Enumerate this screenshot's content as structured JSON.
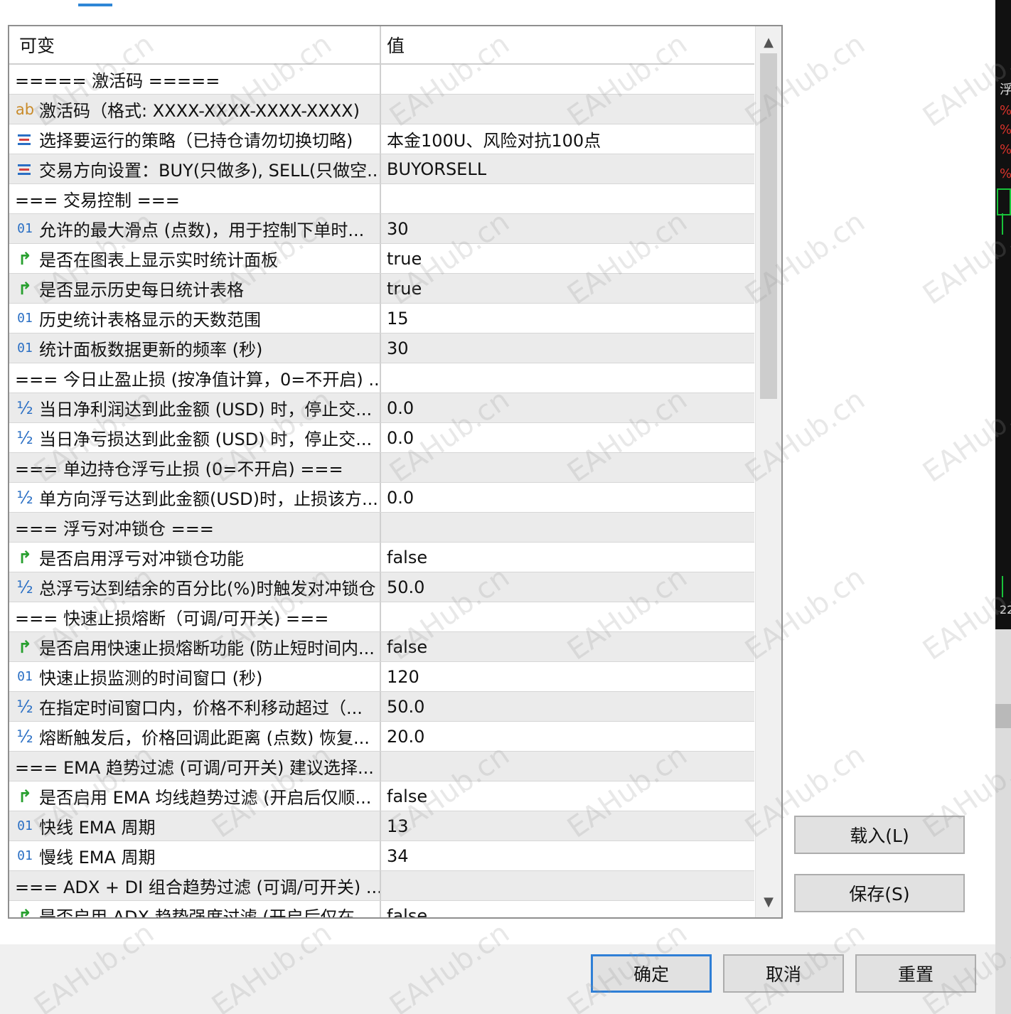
{
  "grid": {
    "headers": {
      "name": "可变",
      "value": "值"
    },
    "rows": [
      {
        "icon": "none",
        "name": "===== 激活码 =====",
        "value": ""
      },
      {
        "icon": "ab",
        "name": "激活码（格式: XXXX-XXXX-XXXX-XXXX)",
        "value": ""
      },
      {
        "icon": "enum",
        "name": "选择要运行的策略（已持仓请勿切换切略)",
        "value": "本金100U、风险对抗100点"
      },
      {
        "icon": "enum",
        "name": "交易方向设置：BUY(只做多), SELL(只做空...",
        "value": "BUYORSELL"
      },
      {
        "icon": "none",
        "name": "=== 交易控制 ===",
        "value": ""
      },
      {
        "icon": "num",
        "name": "允许的最大滑点 (点数)，用于控制下单时...",
        "value": "30"
      },
      {
        "icon": "bool",
        "name": "是否在图表上显示实时统计面板",
        "value": "true"
      },
      {
        "icon": "bool",
        "name": "是否显示历史每日统计表格",
        "value": "true"
      },
      {
        "icon": "num",
        "name": "历史统计表格显示的天数范围",
        "value": "15"
      },
      {
        "icon": "num",
        "name": "统计面板数据更新的频率 (秒)",
        "value": "30"
      },
      {
        "icon": "none",
        "name": "=== 今日止盈止损 (按净值计算，0=不开启) ...",
        "value": ""
      },
      {
        "icon": "frac",
        "name": "当日净利润达到此金额 (USD) 时，停止交...",
        "value": "0.0"
      },
      {
        "icon": "frac",
        "name": "当日净亏损达到此金额 (USD) 时，停止交...",
        "value": "0.0"
      },
      {
        "icon": "none",
        "name": "=== 单边持仓浮亏止损 (0=不开启) ===",
        "value": ""
      },
      {
        "icon": "frac",
        "name": "单方向浮亏达到此金额(USD)时，止损该方...",
        "value": "0.0"
      },
      {
        "icon": "none",
        "name": "=== 浮亏对冲锁仓 ===",
        "value": ""
      },
      {
        "icon": "bool",
        "name": "是否启用浮亏对冲锁仓功能",
        "value": "false"
      },
      {
        "icon": "frac",
        "name": "总浮亏达到结余的百分比(%)时触发对冲锁仓",
        "value": "50.0"
      },
      {
        "icon": "none",
        "name": "=== 快速止损熔断（可调/可开关) ===",
        "value": ""
      },
      {
        "icon": "bool",
        "name": "是否启用快速止损熔断功能 (防止短时间内...",
        "value": "false"
      },
      {
        "icon": "num",
        "name": "快速止损监测的时间窗口 (秒)",
        "value": "120"
      },
      {
        "icon": "frac",
        "name": "在指定时间窗口内，价格不利移动超过（...",
        "value": "50.0"
      },
      {
        "icon": "frac",
        "name": "熔断触发后，价格回调此距离 (点数) 恢复...",
        "value": "20.0"
      },
      {
        "icon": "none",
        "name": "===  EMA 趋势过滤 (可调/可开关) 建议选择...",
        "value": ""
      },
      {
        "icon": "bool",
        "name": "是否启用 EMA 均线趋势过滤 (开启后仅顺...",
        "value": "false"
      },
      {
        "icon": "num",
        "name": "快线 EMA 周期",
        "value": "13"
      },
      {
        "icon": "num",
        "name": "慢线 EMA 周期",
        "value": "34"
      },
      {
        "icon": "none",
        "name": "=== ADX + DI 组合趋势过滤 (可调/可开关) ...",
        "value": ""
      },
      {
        "icon": "bool",
        "name": "是否启用 ADX 趋势强度过滤 (开启后仅在...",
        "value": "false"
      }
    ]
  },
  "icons": {
    "ab": {
      "glyph": "ab",
      "name": "string-type-icon"
    },
    "enum": {
      "glyph": "",
      "name": "enum-type-icon"
    },
    "num": {
      "glyph": "01",
      "name": "integer-type-icon"
    },
    "frac": {
      "glyph": "½",
      "name": "double-type-icon"
    },
    "bool": {
      "glyph": "↱",
      "name": "boolean-type-icon"
    },
    "none": {
      "glyph": "",
      "name": ""
    }
  },
  "side_buttons": {
    "load": "载入(L)",
    "save": "保存(S)"
  },
  "footer": {
    "ok": "确定",
    "cancel": "取消",
    "reset": "重置"
  },
  "watermark": "EAHub.cn",
  "right_strip": {
    "labels": [
      "浮",
      "%",
      "%",
      "%",
      "%",
      "22"
    ]
  },
  "colors": {
    "accent": "#2f7fd6",
    "row_alt": "#ebebeb",
    "bool_icon": "#28a02f",
    "num_icon": "#2a6fc4",
    "string_icon": "#c98b2a"
  }
}
